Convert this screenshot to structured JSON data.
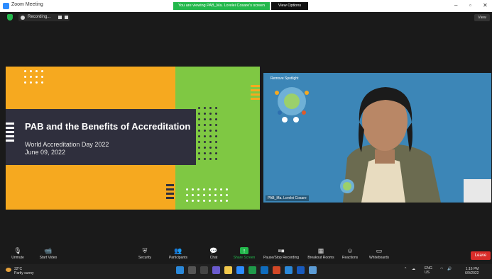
{
  "window": {
    "title": "Zoom Meeting",
    "viewing_banner": "You are viewing PAB_Ma. Lorelei Cosare's screen",
    "view_options": "View Options",
    "view_button": "View"
  },
  "recording": {
    "label": "Recording..."
  },
  "slide": {
    "title": "PAB and the Benefits of Accreditation",
    "subtitle": "World Accreditation Day 2022",
    "date": "June 09, 2022"
  },
  "video": {
    "spotlight": "Remove Spotlight",
    "participant_name": "PAB_Ma. Lorelei Cosare"
  },
  "toolbar": {
    "items": [
      {
        "label": "Unmute",
        "icon": "microphone-muted-icon"
      },
      {
        "label": "Start Video",
        "icon": "video-off-icon"
      },
      {
        "label": "Security",
        "icon": "shield-icon"
      },
      {
        "label": "Participants",
        "icon": "participants-icon",
        "count": "15"
      },
      {
        "label": "Chat",
        "icon": "chat-icon"
      },
      {
        "label": "Share Screen",
        "icon": "share-screen-icon"
      },
      {
        "label": "Pause/Stop Recording",
        "icon": "recording-icon"
      },
      {
        "label": "Breakout Rooms",
        "icon": "breakout-rooms-icon"
      },
      {
        "label": "Reactions",
        "icon": "reactions-icon"
      },
      {
        "label": "Whiteboards",
        "icon": "whiteboard-icon"
      }
    ],
    "leave": "Leave"
  },
  "taskbar": {
    "weather_temp": "32°C",
    "weather_text": "Partly sunny",
    "lang_top": "ENG",
    "lang_bottom": "US",
    "time": "1:16 PM",
    "date": "6/9/2022"
  },
  "colors": {
    "zoom_green": "#23b84c",
    "slide_orange": "#f6a91f",
    "slide_green": "#7fc843",
    "slide_dark": "#2f2f3d",
    "video_bg": "#3c86b7",
    "leave_red": "#d92d2a"
  }
}
